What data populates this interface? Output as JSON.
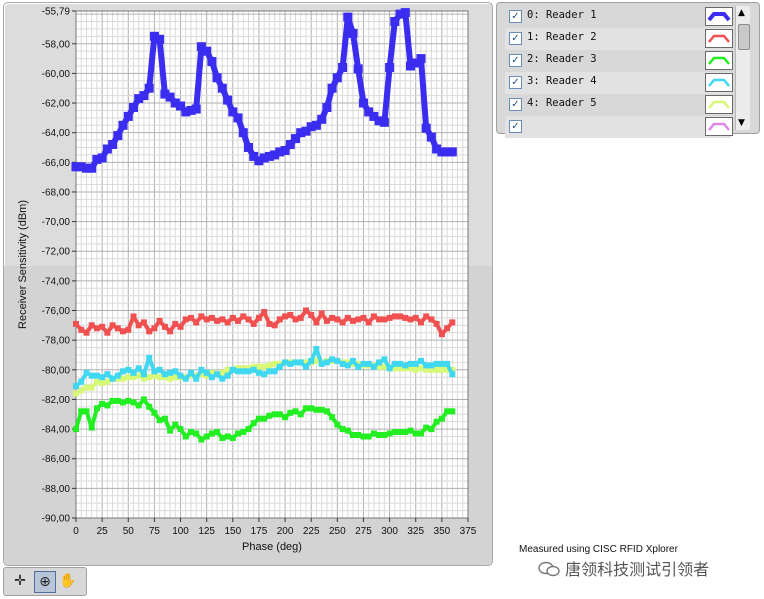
{
  "chart_data": {
    "type": "line",
    "xlabel": "Phase (deg)",
    "ylabel": "Receiver Sensitivity (dBm)",
    "xlim": [
      0,
      375
    ],
    "ylim": [
      -90,
      -55.79
    ],
    "x_ticks": [
      0,
      25,
      50,
      75,
      100,
      125,
      150,
      175,
      200,
      225,
      250,
      275,
      300,
      325,
      350,
      375
    ],
    "y_ticks": [
      -55.79,
      -58,
      -60,
      -62,
      -64,
      -66,
      -68,
      -70,
      -72,
      -74,
      -76,
      -78,
      -80,
      -82,
      -84,
      -86,
      -88,
      -90
    ],
    "x_tick_labels": [
      "0",
      "25",
      "50",
      "75",
      "100",
      "125",
      "150",
      "175",
      "200",
      "225",
      "250",
      "275",
      "300",
      "325",
      "350",
      "375"
    ],
    "y_tick_labels": [
      "-55,79",
      "-58,00",
      "-60,00",
      "-62,00",
      "-64,00",
      "-66,00",
      "-68,00",
      "-70,00",
      "-72,00",
      "-74,00",
      "-76,00",
      "-78,00",
      "-80,00",
      "-82,00",
      "-84,00",
      "-86,00",
      "-88,00",
      "-90,00"
    ],
    "grid": true,
    "legend_position": "top-right outside",
    "series": [
      {
        "name": "Reader 1",
        "color": "#3a2df0",
        "x": [
          0,
          5,
          10,
          15,
          20,
          25,
          30,
          35,
          40,
          45,
          50,
          55,
          60,
          65,
          70,
          75,
          80,
          85,
          90,
          95,
          100,
          105,
          110,
          115,
          120,
          125,
          130,
          135,
          140,
          145,
          150,
          155,
          160,
          165,
          170,
          175,
          180,
          185,
          190,
          195,
          200,
          205,
          210,
          215,
          220,
          225,
          230,
          235,
          240,
          245,
          250,
          255,
          260,
          265,
          270,
          275,
          280,
          285,
          290,
          295,
          300,
          305,
          310,
          315,
          320,
          325,
          330,
          335,
          340,
          345,
          350,
          355,
          360
        ],
        "y": [
          -66.3,
          -66.3,
          -66.4,
          -66.4,
          -65.8,
          -65.7,
          -65.1,
          -64.8,
          -64.2,
          -63.5,
          -62.9,
          -62.3,
          -61.7,
          -61.5,
          -61.0,
          -57.5,
          -57.7,
          -61.4,
          -61.6,
          -62.0,
          -62.2,
          -62.6,
          -62.5,
          -62.4,
          -58.2,
          -58.5,
          -59.2,
          -60.3,
          -61.0,
          -61.8,
          -62.6,
          -63.0,
          -64.0,
          -65.0,
          -65.6,
          -65.9,
          -65.7,
          -65.6,
          -65.5,
          -65.3,
          -65.2,
          -64.8,
          -64.4,
          -64.0,
          -63.9,
          -63.6,
          -63.5,
          -63.1,
          -62.3,
          -61.0,
          -60.3,
          -59.6,
          -56.2,
          -57.3,
          -59.7,
          -62.0,
          -62.6,
          -62.9,
          -63.2,
          -63.3,
          -59.6,
          -56.5,
          -56.0,
          -55.9,
          -59.5,
          -59.3,
          -59.0,
          -63.7,
          -64.3,
          -65.1,
          -65.3,
          -65.3,
          -65.3
        ]
      },
      {
        "name": "Reader 2",
        "color": "#f05050",
        "x": [
          0,
          5,
          10,
          15,
          20,
          25,
          30,
          35,
          40,
          45,
          50,
          55,
          60,
          65,
          70,
          75,
          80,
          85,
          90,
          95,
          100,
          105,
          110,
          115,
          120,
          125,
          130,
          135,
          140,
          145,
          150,
          155,
          160,
          165,
          170,
          175,
          180,
          185,
          190,
          195,
          200,
          205,
          210,
          215,
          220,
          225,
          230,
          235,
          240,
          245,
          250,
          255,
          260,
          265,
          270,
          275,
          280,
          285,
          290,
          295,
          300,
          305,
          310,
          315,
          320,
          325,
          330,
          335,
          340,
          345,
          350,
          355,
          360
        ],
        "y": [
          -76.9,
          -77.3,
          -77.5,
          -77.0,
          -77.2,
          -77.1,
          -77.5,
          -77.0,
          -77.2,
          -77.4,
          -77.3,
          -76.4,
          -77.0,
          -76.8,
          -77.4,
          -77.2,
          -76.7,
          -77.1,
          -77.4,
          -76.9,
          -77.1,
          -76.6,
          -76.5,
          -76.8,
          -76.4,
          -76.6,
          -76.5,
          -76.7,
          -76.6,
          -76.8,
          -76.5,
          -76.7,
          -76.4,
          -76.6,
          -76.9,
          -76.5,
          -76.1,
          -76.9,
          -77.0,
          -76.6,
          -76.4,
          -76.3,
          -76.6,
          -76.5,
          -76.0,
          -76.3,
          -76.8,
          -76.2,
          -76.7,
          -76.5,
          -76.6,
          -76.8,
          -76.5,
          -76.7,
          -76.6,
          -76.5,
          -76.8,
          -76.4,
          -76.6,
          -76.6,
          -76.5,
          -76.4,
          -76.4,
          -76.5,
          -76.6,
          -76.5,
          -76.8,
          -76.4,
          -76.6,
          -76.9,
          -77.6,
          -77.2,
          -76.8
        ]
      },
      {
        "name": "Reader 3",
        "color": "#22ee22",
        "x": [
          0,
          5,
          10,
          15,
          20,
          25,
          30,
          35,
          40,
          45,
          50,
          55,
          60,
          65,
          70,
          75,
          80,
          85,
          90,
          95,
          100,
          105,
          110,
          115,
          120,
          125,
          130,
          135,
          140,
          145,
          150,
          155,
          160,
          165,
          170,
          175,
          180,
          185,
          190,
          195,
          200,
          205,
          210,
          215,
          220,
          225,
          230,
          235,
          240,
          245,
          250,
          255,
          260,
          265,
          270,
          275,
          280,
          285,
          290,
          295,
          300,
          305,
          310,
          315,
          320,
          325,
          330,
          335,
          340,
          345,
          350,
          355,
          360
        ],
        "y": [
          -84.0,
          -82.8,
          -82.8,
          -83.9,
          -82.6,
          -82.3,
          -82.4,
          -82.1,
          -82.1,
          -82.2,
          -82.1,
          -82.2,
          -82.4,
          -82.0,
          -82.5,
          -82.9,
          -83.4,
          -83.3,
          -84.1,
          -83.7,
          -84.0,
          -84.5,
          -84.2,
          -84.3,
          -84.7,
          -84.5,
          -84.3,
          -84.2,
          -84.6,
          -84.5,
          -84.6,
          -84.3,
          -84.2,
          -84.0,
          -83.6,
          -83.3,
          -83.3,
          -83.1,
          -83.0,
          -83.0,
          -83.2,
          -82.9,
          -82.8,
          -83.0,
          -82.6,
          -82.6,
          -82.7,
          -82.7,
          -82.8,
          -83.2,
          -83.7,
          -84.0,
          -84.1,
          -84.4,
          -84.4,
          -84.5,
          -84.5,
          -84.3,
          -84.4,
          -84.4,
          -84.3,
          -84.2,
          -84.2,
          -84.2,
          -84.1,
          -84.3,
          -84.3,
          -83.9,
          -84.0,
          -83.5,
          -83.3,
          -82.8,
          -82.8
        ]
      },
      {
        "name": "Reader 4",
        "color": "#40d8f0",
        "x": [
          0,
          5,
          10,
          15,
          20,
          25,
          30,
          35,
          40,
          45,
          50,
          55,
          60,
          65,
          70,
          75,
          80,
          85,
          90,
          95,
          100,
          105,
          110,
          115,
          120,
          125,
          130,
          135,
          140,
          145,
          150,
          155,
          160,
          165,
          170,
          175,
          180,
          185,
          190,
          195,
          200,
          205,
          210,
          215,
          220,
          225,
          230,
          235,
          240,
          245,
          250,
          255,
          260,
          265,
          270,
          275,
          280,
          285,
          290,
          295,
          300,
          305,
          310,
          315,
          320,
          325,
          330,
          335,
          340,
          345,
          350,
          355,
          360
        ],
        "y": [
          -81.1,
          -80.8,
          -80.2,
          -80.4,
          -80.4,
          -80.5,
          -80.3,
          -80.6,
          -80.4,
          -80.1,
          -80.0,
          -80.2,
          -79.9,
          -80.3,
          -79.2,
          -80.1,
          -80.0,
          -80.3,
          -80.2,
          -80.1,
          -80.4,
          -80.6,
          -80.2,
          -80.6,
          -80.0,
          -80.2,
          -80.5,
          -80.3,
          -80.6,
          -80.4,
          -80.0,
          -80.1,
          -80.1,
          -80.1,
          -80.0,
          -80.2,
          -80.3,
          -80.1,
          -80.1,
          -79.8,
          -79.5,
          -79.6,
          -79.5,
          -79.5,
          -79.8,
          -79.4,
          -78.6,
          -79.6,
          -79.5,
          -79.3,
          -79.4,
          -79.6,
          -79.7,
          -79.4,
          -79.8,
          -79.6,
          -79.6,
          -79.8,
          -79.5,
          -79.3,
          -79.9,
          -79.6,
          -79.6,
          -79.7,
          -79.6,
          -79.6,
          -79.4,
          -79.7,
          -79.7,
          -79.6,
          -79.6,
          -79.6,
          -80.3
        ]
      },
      {
        "name": "Reader 5",
        "color": "#d8f878",
        "x": [
          0,
          5,
          10,
          15,
          20,
          25,
          30,
          35,
          40,
          45,
          50,
          55,
          60,
          65,
          70,
          75,
          80,
          85,
          90,
          95,
          100,
          105,
          110,
          115,
          120,
          125,
          130,
          135,
          140,
          145,
          150,
          155,
          160,
          165,
          170,
          175,
          180,
          185,
          190,
          195,
          200,
          205,
          210,
          215,
          220,
          225,
          230,
          235,
          240,
          245,
          250,
          255,
          260,
          265,
          270,
          275,
          280,
          285,
          290,
          295,
          300,
          305,
          310,
          315,
          320,
          325,
          330,
          335,
          340,
          345,
          350,
          355,
          360
        ],
        "y": [
          -81.6,
          -81.4,
          -81.2,
          -81.2,
          -80.8,
          -80.9,
          -80.8,
          -80.6,
          -80.6,
          -80.6,
          -80.5,
          -80.5,
          -80.4,
          -80.6,
          -80.5,
          -80.4,
          -80.5,
          -80.5,
          -80.6,
          -80.5,
          -80.5,
          -80.5,
          -80.4,
          -80.4,
          -80.3,
          -80.4,
          -80.2,
          -80.3,
          -80.2,
          -80.0,
          -80.0,
          -79.9,
          -79.9,
          -79.9,
          -79.8,
          -79.8,
          -79.8,
          -79.7,
          -79.6,
          -79.6,
          -79.5,
          -79.5,
          -79.5,
          -79.5,
          -79.5,
          -79.5,
          -79.4,
          -79.5,
          -79.4,
          -79.4,
          -79.4,
          -79.5,
          -79.5,
          -79.6,
          -79.6,
          -79.7,
          -79.7,
          -79.7,
          -79.8,
          -79.8,
          -79.9,
          -79.9,
          -79.9,
          -79.9,
          -79.9,
          -80.0,
          -79.9,
          -80.0,
          -80.0,
          -80.0,
          -80.0,
          -80.0,
          -80.0
        ]
      }
    ],
    "annotation": "Measured using CISC RFID Xplorer"
  },
  "legend": {
    "items": [
      {
        "label": "0: Reader 1",
        "color": "#3a2df0",
        "checked": true
      },
      {
        "label": "1: Reader 2",
        "color": "#f05050",
        "checked": true
      },
      {
        "label": "2: Reader 3",
        "color": "#22ee22",
        "checked": true
      },
      {
        "label": "3: Reader 4",
        "color": "#40d8f0",
        "checked": true
      },
      {
        "label": "4: Reader 5",
        "color": "#d8f878",
        "checked": true
      },
      {
        "label": "",
        "color": "#e088e8",
        "checked": true
      }
    ],
    "check_glyph": "✓",
    "scroll_up": "▲",
    "scroll_down": "▼"
  },
  "tools": {
    "cursor_icon": "cursor-tool-icon",
    "zoom_icon": "zoom-tool-icon",
    "pan_icon": "pan-tool-icon",
    "cursor_glyph": "✛",
    "zoom_glyph": "⊕",
    "pan_glyph": "✋"
  },
  "watermark": "唐领科技测试引领者"
}
